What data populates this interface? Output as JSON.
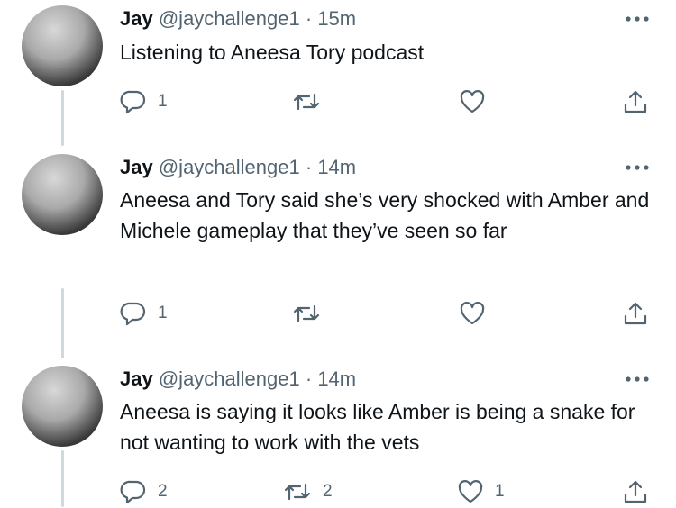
{
  "tweets": [
    {
      "name": "Jay",
      "handle": "@jaychallenge1",
      "separator": "·",
      "time": "15m",
      "text": "Listening to Aneesa Tory podcast",
      "replies": "1",
      "retweets": "",
      "likes": ""
    },
    {
      "name": "Jay",
      "handle": "@jaychallenge1",
      "separator": "·",
      "time": "14m",
      "text": "Aneesa and Tory said she’s very shocked with Amber and Michele gameplay that they’ve seen so far",
      "replies": "1",
      "retweets": "",
      "likes": ""
    },
    {
      "name": "Jay",
      "handle": "@jaychallenge1",
      "separator": "·",
      "time": "14m",
      "text": "Aneesa is saying it looks like Amber is being a snake for not wanting to work with the vets",
      "replies": "2",
      "retweets": "2",
      "likes": "1"
    }
  ],
  "icons": {
    "reply": "reply-icon",
    "retweet": "retweet-icon",
    "like": "heart-icon",
    "share": "share-icon",
    "more": "more-icon"
  },
  "colors": {
    "text": "#0f1419",
    "secondary": "#536471",
    "thread_line": "#cfd9de"
  }
}
